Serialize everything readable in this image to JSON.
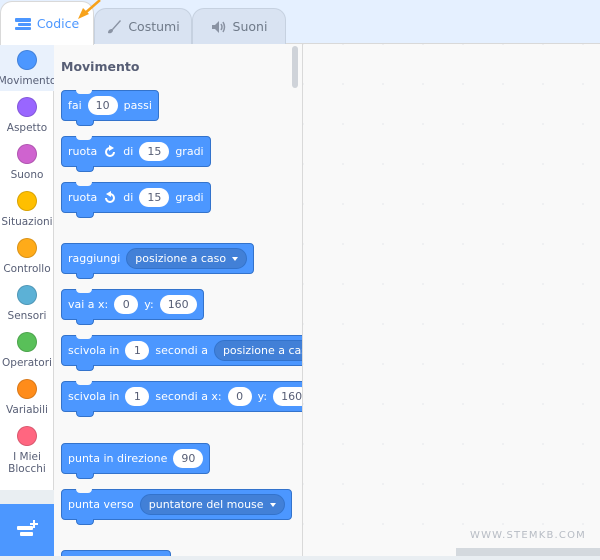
{
  "tabs": [
    {
      "label": "Codice",
      "icon": "code-icon",
      "active": true
    },
    {
      "label": "Costumi",
      "icon": "brush-icon",
      "active": false
    },
    {
      "label": "Suoni",
      "icon": "speaker-icon",
      "active": false
    }
  ],
  "categories": [
    {
      "label": "Movimento",
      "color": "#4c97ff",
      "selected": true
    },
    {
      "label": "Aspetto",
      "color": "#9966ff"
    },
    {
      "label": "Suono",
      "color": "#cf63cf"
    },
    {
      "label": "Situazioni",
      "color": "#ffbf00"
    },
    {
      "label": "Controllo",
      "color": "#ffab19"
    },
    {
      "label": "Sensori",
      "color": "#5cb1d6"
    },
    {
      "label": "Operatori",
      "color": "#59c059"
    },
    {
      "label": "Variabili",
      "color": "#ff8c1a"
    },
    {
      "label_line1": "I Miei",
      "label_line2": "Blocchi",
      "color": "#ff6680"
    }
  ],
  "palette": {
    "title": "Movimento",
    "blocks": {
      "move": {
        "text1": "fai",
        "value": "10",
        "text2": "passi"
      },
      "turn_right": {
        "text1": "ruota",
        "text2": "di",
        "value": "15",
        "text3": "gradi"
      },
      "turn_left": {
        "text1": "ruota",
        "text2": "di",
        "value": "15",
        "text3": "gradi"
      },
      "goto": {
        "text1": "raggiungi",
        "dropdown": "posizione a caso"
      },
      "goto_xy": {
        "text1": "vai a x:",
        "x": "0",
        "text2": "y:",
        "y": "160"
      },
      "glide_random": {
        "text1": "scivola in",
        "value": "1",
        "text2": "secondi a",
        "dropdown": "posizione a caso"
      },
      "glide_xy": {
        "text1": "scivola in",
        "value": "1",
        "text2": "secondi a x:",
        "x": "0",
        "text3": "y:",
        "y": "160"
      },
      "point_direction": {
        "text1": "punta in direzione",
        "value": "90"
      },
      "point_towards": {
        "text1": "punta verso",
        "dropdown": "puntatore del mouse"
      }
    }
  },
  "watermark": "WWW.STEMKB.COM",
  "colors": {
    "motion": "#4c97ff",
    "accent": "#4c97ff",
    "arrow": "#f7a21b"
  }
}
